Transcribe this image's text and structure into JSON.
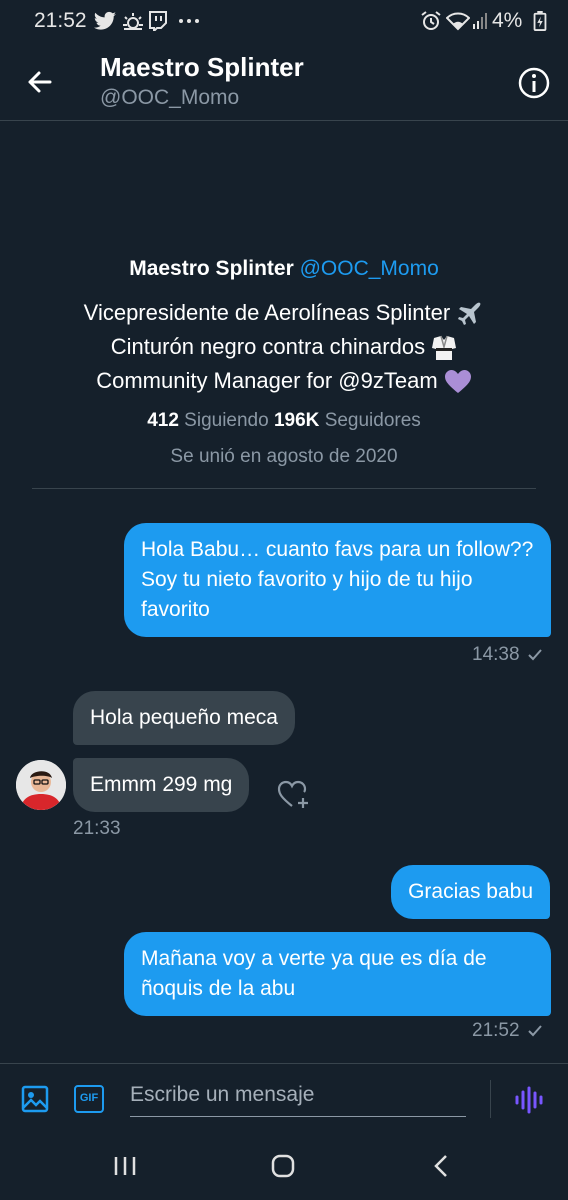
{
  "status_bar": {
    "time": "21:52",
    "icons_left": [
      "twitter-icon",
      "weather-icon",
      "twitch-icon",
      "more-dots-icon"
    ],
    "icons_right": [
      "alarm-icon",
      "wifi-icon",
      "signal-icon",
      "battery-icon"
    ],
    "battery": "4%"
  },
  "header": {
    "name": "Maestro Splinter",
    "handle": "@OOC_Momo",
    "back_icon": "back-arrow-icon",
    "info_icon": "info-icon"
  },
  "profile": {
    "name": "Maestro Splinter",
    "handle": "@OOC_Momo",
    "bio_lines": [
      "Vicepresidente de Aerolíneas Splinter",
      "Cinturón negro contra chinardos",
      "Community Manager for @9zTeam"
    ],
    "following_count": "412",
    "following_label": "Siguiendo",
    "followers_count": "196K",
    "followers_label": "Seguidores",
    "joined": "Se unió en agosto de 2020"
  },
  "messages": [
    {
      "from": "me",
      "text": "Hola Babu… cuanto favs para un follow?? Soy tu nieto favorito y hijo de tu hijo favorito",
      "time": "14:38"
    },
    {
      "from": "them",
      "text": "Hola pequeño meca"
    },
    {
      "from": "them",
      "text": "Emmm 299 mg",
      "time": "21:33"
    },
    {
      "from": "me",
      "text": "Gracias babu"
    },
    {
      "from": "me",
      "text": "Mañana voy a verte ya que es día de ñoquis de la abu",
      "time": "21:52"
    }
  ],
  "composer": {
    "placeholder": "Escribe un mensaje",
    "image_icon": "image-icon",
    "gif_label": "GIF",
    "voice_icon": "voice-icon"
  },
  "nav": {
    "recent_icon": "recent-apps-icon",
    "home_icon": "home-icon",
    "back_icon": "back-icon"
  },
  "colors": {
    "background": "#15202b",
    "accent": "#1d9bf0",
    "received_bubble": "#38444d",
    "secondary_text": "#8b98a5",
    "voice": "#7856ff"
  }
}
